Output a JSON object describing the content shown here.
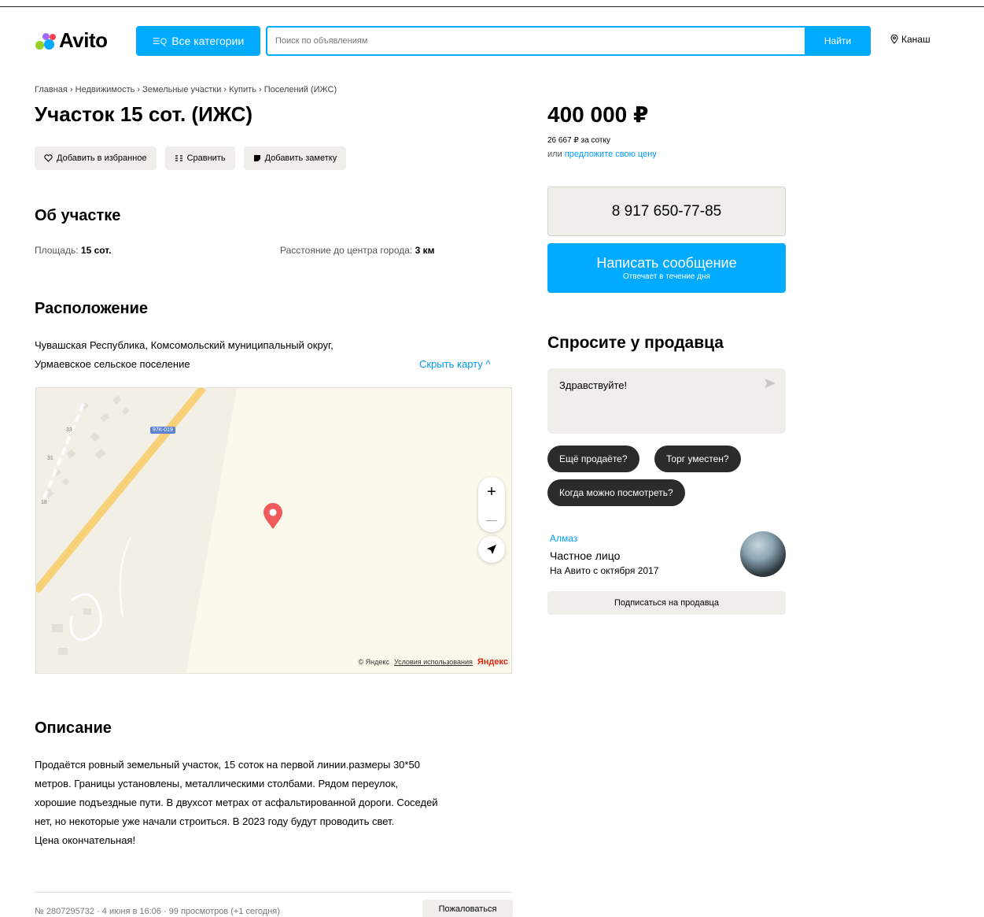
{
  "header": {
    "logo_text": "Avito",
    "category_button": "Все категории",
    "search_placeholder": "Поиск по объявлениям",
    "search_button": "Найти",
    "city": "Канаш"
  },
  "breadcrumbs": [
    "Главная",
    "Недвижимость",
    "Земельные участки",
    "Купить",
    "Поселений (ИЖС)"
  ],
  "listing": {
    "title": "Участок 15 сот. (ИЖС)",
    "actions": [
      "Добавить в избранное",
      "Сравнить",
      "Добавить заметку"
    ]
  },
  "about": {
    "heading": "Об участке",
    "params": [
      {
        "label": "Площадь:",
        "value": "15 сот."
      },
      {
        "label": "Расстояние до центра города:",
        "value": "3 км"
      }
    ]
  },
  "location": {
    "heading": "Расположение",
    "address_line1": "Чувашская Республика, Комсомольский муниципальный округ,",
    "address_line2": "Урмаевское сельское поселение",
    "hide_map": "Скрыть карту ^",
    "map": {
      "road_label": "97К-019",
      "house_numbers": [
        "33",
        "31",
        "18"
      ],
      "zoom_in": "+",
      "zoom_out": "—",
      "copyright": "© Яндекс",
      "terms_link": "Условия использования",
      "yandex_logo": "Яндекс"
    }
  },
  "description": {
    "heading": "Описание",
    "lines": [
      "Продаётся ровный земельный участок, 15 соток на первой линии.размеры 30*50",
      "метров. Границы установлены, металлическими столбами. Рядом переулок,",
      "хорошие подъездные пути. В двухсот метрах от асфальтированной дороги. Соседей",
      "нет, но некоторые уже начали строиться. В 2023 году будут проводить свет.",
      "Цена окончательная!"
    ]
  },
  "footer": {
    "meta": "№ 2807295732 · 4 июня в 16:06 · 99 просмотров (+1 сегодня)",
    "report_button": "Пожаловаться"
  },
  "sidebar": {
    "price": "400 000 ₽",
    "price_per": "26 667 ₽ за сотку",
    "offer_prefix": "или",
    "offer_link": "предложите свою цену",
    "phone": "8 917 650-77-85",
    "message_button": "Написать сообщение",
    "message_sub": "Отвечает в течение дня",
    "ask_heading": "Спросите у продавца",
    "ask_text": "Здравствуйте!",
    "quick_questions": [
      "Ещё продаёте?",
      "Торг уместен?",
      "Когда можно посмотреть?"
    ],
    "seller_name": "Алмаз",
    "seller_type": "Частное лицо",
    "seller_since": "На Авито с октября 2017",
    "subscribe_button": "Подписаться на продавца"
  },
  "colors": {
    "accent": "#00aaff",
    "link": "#0099f7",
    "chip": "#2b2b2b",
    "pin": "#f05a5a",
    "road": "#f7d27a"
  }
}
